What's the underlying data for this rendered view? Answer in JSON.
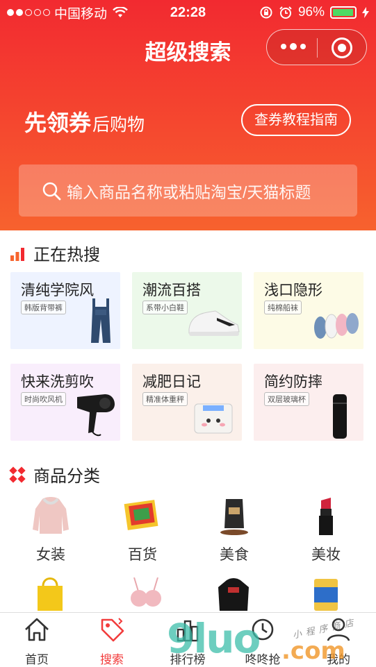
{
  "status_bar": {
    "carrier": "中国移动",
    "time": "22:28",
    "battery": "96%",
    "battery_level": 0.96
  },
  "nav": {
    "title": "超级搜索"
  },
  "hero": {
    "slogan_big": "先领券",
    "slogan_small": "后购物",
    "guide_button": "查券教程指南",
    "search_placeholder": "输入商品名称或粘贴淘宝/天猫标题"
  },
  "hot": {
    "title": "正在热搜",
    "cards": [
      {
        "title": "清纯学院风",
        "tag": "韩版背带裤",
        "bg": "#eef3ff"
      },
      {
        "title": "潮流百搭",
        "tag": "系带小白鞋",
        "bg": "#ecf9ea"
      },
      {
        "title": "浅口隐形",
        "tag": "纯棉船袜",
        "bg": "#fdfbe6"
      },
      {
        "title": "快来洗剪吹",
        "tag": "时尚吹风机",
        "bg": "#f9eefc"
      },
      {
        "title": "减肥日记",
        "tag": "精准体重秤",
        "bg": "#fbf0ea"
      },
      {
        "title": "简约防摔",
        "tag": "双层玻璃杯",
        "bg": "#fceeee"
      }
    ]
  },
  "category": {
    "title": "商品分类",
    "items": [
      {
        "label": "女装",
        "icon": "coat-icon"
      },
      {
        "label": "百货",
        "icon": "mats-icon"
      },
      {
        "label": "美食",
        "icon": "coffee-bag-icon"
      },
      {
        "label": "美妆",
        "icon": "lipstick-icon"
      }
    ]
  },
  "tabs": [
    {
      "label": "首页",
      "icon": "home-icon"
    },
    {
      "label": "搜索",
      "icon": "tag-icon"
    },
    {
      "label": "排行榜",
      "icon": "rank-icon"
    },
    {
      "label": "咚咚抢",
      "icon": "clock-icon"
    },
    {
      "label": "我的",
      "icon": "user-icon"
    }
  ],
  "watermark": {
    "main": "9luo",
    "suffix": ".com",
    "script": "小程序商店"
  },
  "colors": {
    "accent": "#f23c3c",
    "hero_top": "#f22a30",
    "hero_bottom": "#f7622e"
  }
}
